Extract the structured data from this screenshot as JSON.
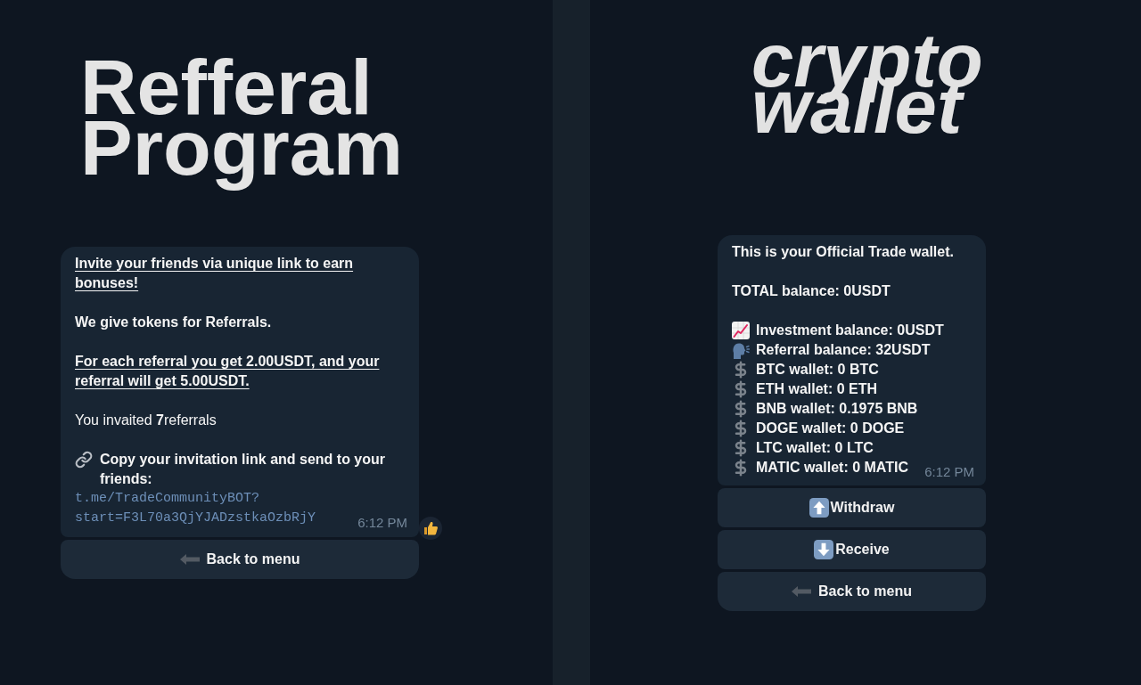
{
  "referral_panel": {
    "title_lines": [
      "Refferal",
      "Program"
    ],
    "message": {
      "paragraphs": [
        {
          "kind": "underlined",
          "text": "Invite your friends via unique link to earn bonuses!"
        },
        {
          "kind": "bold",
          "text": "We give tokens for Referrals."
        },
        {
          "kind": "underlined",
          "text": "For each referral you get 2.00USDT, and your referral will get 5.00USDT."
        },
        {
          "kind": "plain",
          "text": "You invaited **7**referrals"
        }
      ],
      "invite": {
        "text": "Copy your invitation link and send to your friends:",
        "link_lines": [
          "t.me/TradeCommunityBOT?",
          "start=F3L70a3QjYJADzstkaOzbRjY"
        ]
      },
      "time": "6:12 PM",
      "reacted": true
    },
    "buttons": [
      {
        "kind": "back",
        "label": "Back to menu"
      }
    ]
  },
  "wallet_panel": {
    "logo_lines": [
      "crypto",
      "wallet"
    ],
    "message": {
      "heading": "This is your Official Trade wallet.",
      "total": "TOTAL balance: 0USDT",
      "rows": [
        {
          "kind": "chart",
          "text": "Investment balance: 0USDT"
        },
        {
          "kind": "speech",
          "text": "Referral balance: 32USDT"
        },
        {
          "kind": "dollar",
          "text": "BTC wallet: 0 BTC"
        },
        {
          "kind": "dollar",
          "text": "ETH wallet: 0 ETH"
        },
        {
          "kind": "dollar",
          "text": "BNB wallet: 0.1975 BNB"
        },
        {
          "kind": "dollar",
          "text": "DOGE wallet: 0 DOGE"
        },
        {
          "kind": "dollar",
          "text": "LTC wallet: 0 LTC"
        },
        {
          "kind": "dollar",
          "text": "MATIC wallet: 0 MATIC"
        }
      ],
      "time": "6:12 PM"
    },
    "buttons": [
      {
        "kind": "up",
        "label": "Withdraw"
      },
      {
        "kind": "down",
        "label": "Receive"
      },
      {
        "kind": "back",
        "label": "Back to menu"
      }
    ]
  }
}
